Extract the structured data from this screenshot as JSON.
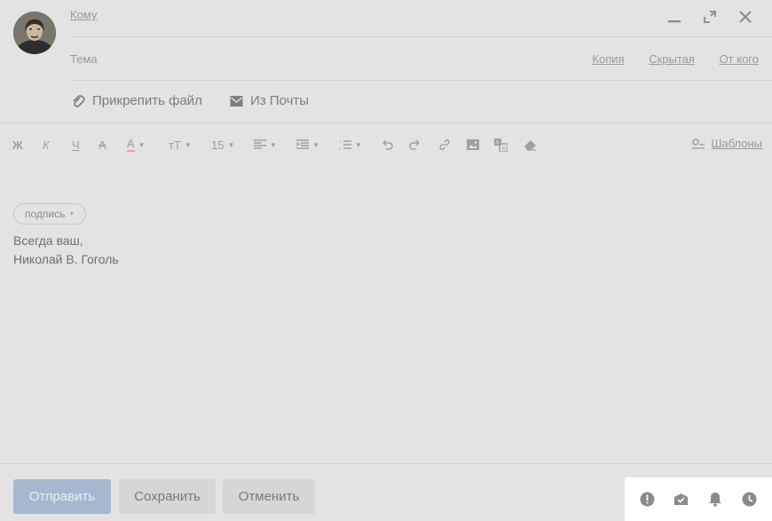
{
  "header": {
    "to_label": "Кому",
    "subject_placeholder": "Тема",
    "links": {
      "cc": "Копия",
      "bcc": "Скрытая",
      "from": "От кого"
    }
  },
  "attach": {
    "attach_file": "Прикрепить файл",
    "from_mail": "Из Почты"
  },
  "toolbar": {
    "bold": "Ж",
    "italic": "К",
    "underline": "Ч",
    "strike": "А",
    "color": "А",
    "font_size": "15",
    "templates": "Шаблоны"
  },
  "editor": {
    "signature_chip": "подпись",
    "lines": [
      "Всегда ваш,",
      "Николай В. Гоголь"
    ]
  },
  "footer": {
    "send": "Отправить",
    "save": "Сохранить",
    "cancel": "Отменить"
  }
}
